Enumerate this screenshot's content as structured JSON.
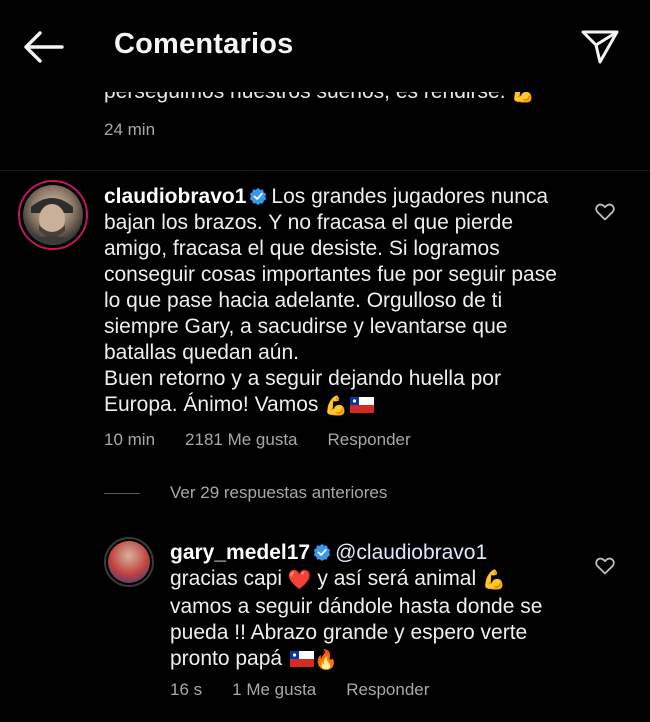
{
  "header": {
    "title": "Comentarios",
    "back_icon": "arrow-left-icon",
    "share_icon": "paper-plane-icon"
  },
  "previous_comment": {
    "text_tail": "perseguimos nuestros sueños, es rendirse.",
    "emoji": "💪",
    "time": "24 min"
  },
  "comment_main": {
    "username": "claudiobravo1",
    "verified": true,
    "text": "Los grandes jugadores nunca bajan los brazos. Y no fracasa el que pierde amigo, fracasa el que desiste. Si logramos conseguir cosas importantes fue por seguir pase lo que pase hacia adelante. Orgulloso de ti siempre Gary, a sacudirse y levantarse que batallas quedan aún.\nBuen retorno y a seguir dejando huella por Europa. Ánimo! Vamos",
    "emoji": "💪",
    "flag": "chile-flag",
    "time": "10 min",
    "likes": "2181 Me gusta",
    "reply_label": "Responder"
  },
  "view_replies": {
    "label": "Ver 29 respuestas anteriores"
  },
  "reply": {
    "username": "gary_medel17",
    "verified": true,
    "mention": "@claudiobravo1",
    "text_part1": "gracias capi",
    "heart_emoji": "❤️",
    "text_part2": "y así será animal",
    "emoji_muscle": "💪",
    "text_part3": "vamos a seguir dándole hasta donde se pueda !! Abrazo grande y espero verte pronto papá",
    "flag": "chile-flag",
    "emoji_fire": "🔥",
    "time": "16 s",
    "likes": "1 Me gusta",
    "reply_label": "Responder"
  },
  "colors": {
    "background": "#000000",
    "text": "#efefef",
    "meta": "#a8a8a8",
    "verified": "#3897f0",
    "story_ring": "#c2185b"
  }
}
